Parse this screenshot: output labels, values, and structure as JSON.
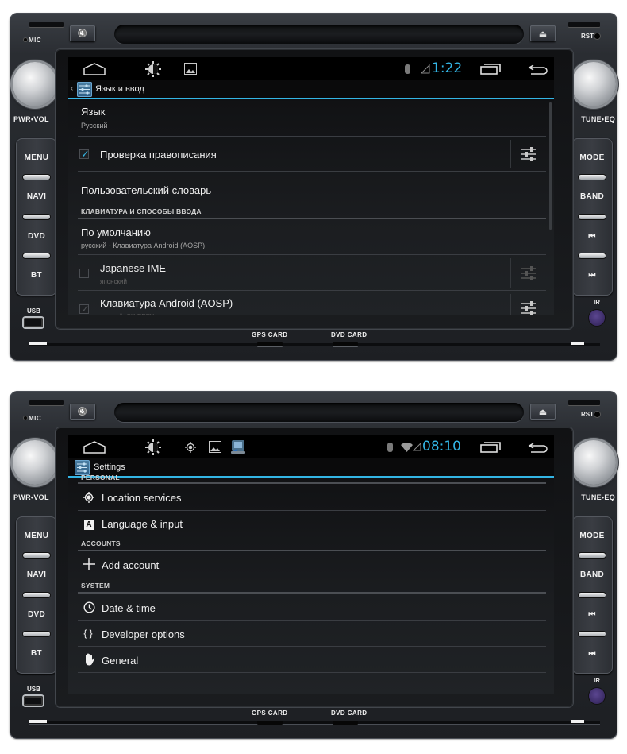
{
  "hardware": {
    "mic_label": "MIC",
    "rst_label": "RST",
    "left_knob_label": "PWR•VOL",
    "right_knob_label": "TUNE•EQ",
    "left_buttons": [
      "MENU",
      "NAVI",
      "DVD",
      "BT"
    ],
    "right_buttons": [
      "MODE",
      "BAND",
      "⏮",
      "⏭"
    ],
    "right_button_names": [
      "mode",
      "band",
      "prev-track",
      "next-track"
    ],
    "usb_label": "USB",
    "ir_label": "IR",
    "gps_card_label": "GPS CARD",
    "dvd_card_label": "DVD CARD",
    "mute_icon": "🔇",
    "eject_icon": "⏏",
    "accent_color": "#33b5e5"
  },
  "screen1": {
    "statusbar": {
      "time": "1:22",
      "icons": [
        "home-icon",
        "brightness-icon",
        "gallery-icon",
        "bluetooth-icon",
        "signal-icon",
        "recent-apps-icon",
        "back-icon"
      ]
    },
    "actionbar": {
      "title": "Язык и ввод",
      "back_glyph": "‹"
    },
    "items": [
      {
        "title": "Язык",
        "summary": "Русский"
      },
      {
        "title": "Проверка правописания",
        "checked": true
      },
      {
        "title": "Пользовательский словарь"
      }
    ],
    "category": "КЛАВИАТУРА И СПОСОБЫ ВВОДА",
    "ime_items": [
      {
        "title": "По умолчанию",
        "summary": "русский - Клавиатура Android (AOSP)"
      },
      {
        "title": "Japanese IME",
        "summary": "японский",
        "checked": false
      },
      {
        "title": "Клавиатура Android (AOSP)",
        "summary": "русский, QWERTY, латиница",
        "checked": true
      }
    ]
  },
  "screen2": {
    "statusbar": {
      "time": "08:10",
      "icons": [
        "home-icon",
        "brightness-icon",
        "location-icon",
        "gallery-icon",
        "igo-navigation-icon",
        "bluetooth-icon",
        "wifi-icon",
        "signal-icon",
        "recent-apps-icon",
        "back-icon"
      ]
    },
    "actionbar": {
      "title": "Settings"
    },
    "sections": [
      {
        "header": "PERSONAL",
        "items": [
          {
            "title": "Location services",
            "icon": "location-icon",
            "glyph": "◈"
          },
          {
            "title": "Language & input",
            "icon": "language-icon",
            "glyph": "A"
          }
        ]
      },
      {
        "header": "ACCOUNTS",
        "items": [
          {
            "title": "Add account",
            "icon": "plus-icon",
            "glyph": "+"
          }
        ]
      },
      {
        "header": "SYSTEM",
        "items": [
          {
            "title": "Date & time",
            "icon": "clock-icon",
            "glyph": "🕓"
          },
          {
            "title": "Developer options",
            "icon": "braces-icon",
            "glyph": "{ }"
          },
          {
            "title": "General",
            "icon": "hand-icon",
            "glyph": "✋"
          }
        ]
      }
    ]
  }
}
